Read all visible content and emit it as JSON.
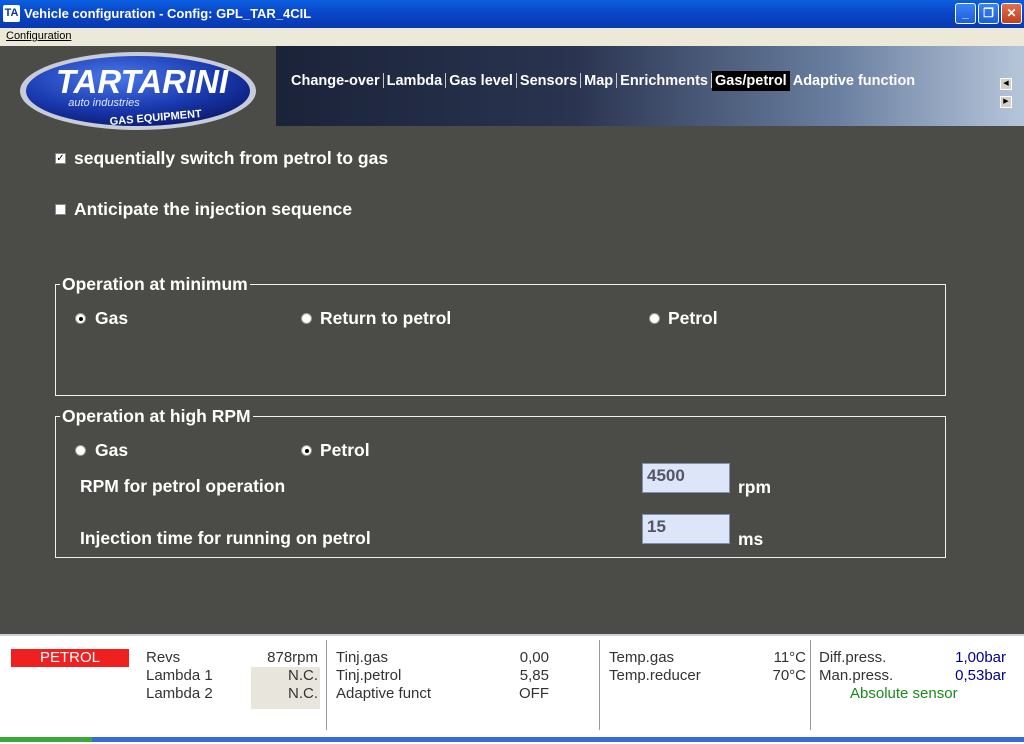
{
  "window": {
    "title": "Vehicle configuration - Config: GPL_TAR_4CIL",
    "app_icon": "TA",
    "min_label": "_",
    "max_label": "❐",
    "close_label": "✕"
  },
  "menubar": {
    "items": [
      {
        "label": "Configuration"
      }
    ]
  },
  "logo": {
    "brand": "TARTARINI",
    "sub1": "auto industries",
    "sub2": "GAS EQUIPMENT"
  },
  "tabs": [
    {
      "label": "Change-over",
      "active": false
    },
    {
      "label": "Lambda",
      "active": false
    },
    {
      "label": "Gas level",
      "active": false
    },
    {
      "label": "Sensors",
      "active": false
    },
    {
      "label": "Map",
      "active": false
    },
    {
      "label": "Enrichments",
      "active": false
    },
    {
      "label": "Gas/petrol",
      "active": true
    },
    {
      "label": "Adaptive function",
      "active": false
    }
  ],
  "options": {
    "sequential_switch": {
      "label": "sequentially switch from petrol to gas",
      "checked": true
    },
    "anticipate": {
      "label": "Anticipate the injection sequence",
      "checked": false
    }
  },
  "group_minimum": {
    "title": "Operation at minimum",
    "options": [
      "Gas",
      "Return to petrol",
      "Petrol"
    ],
    "selected": "Gas"
  },
  "group_high_rpm": {
    "title": "Operation at high RPM",
    "options": [
      "Gas",
      "Petrol"
    ],
    "selected": "Petrol",
    "rpm_label": "RPM for petrol operation",
    "rpm_value": "4500",
    "rpm_unit": "rpm",
    "injtime_label": "Injection time for running on petrol",
    "injtime_value": "15",
    "injtime_unit": "ms"
  },
  "status": {
    "mode": "PETROL",
    "revs_label": "Revs",
    "revs_value": "878rpm",
    "lambda1_label": "Lambda 1",
    "lambda1_value": "N.C.",
    "lambda2_label": "Lambda 2",
    "lambda2_value": "N.C.",
    "tinj_gas_label": "Tinj.gas",
    "tinj_gas_value": "0,00",
    "tinj_petrol_label": "Tinj.petrol",
    "tinj_petrol_value": "5,85",
    "adaptive_label": "Adaptive funct",
    "adaptive_value": "OFF",
    "temp_gas_label": "Temp.gas",
    "temp_gas_value": "11°C",
    "temp_reducer_label": "Temp.reducer",
    "temp_reducer_value": "70°C",
    "diff_press_label": "Diff.press.",
    "diff_press_value": "1,00bar",
    "man_press_label": "Man.press.",
    "man_press_value": "0,53bar",
    "sensor_note": "Absolute sensor"
  },
  "colors": {
    "background": "#4b4b47",
    "titlebar": "#0a46c8",
    "badge": "#f02020",
    "blue_value": "#00008a",
    "green_note": "#1a8a1a"
  }
}
